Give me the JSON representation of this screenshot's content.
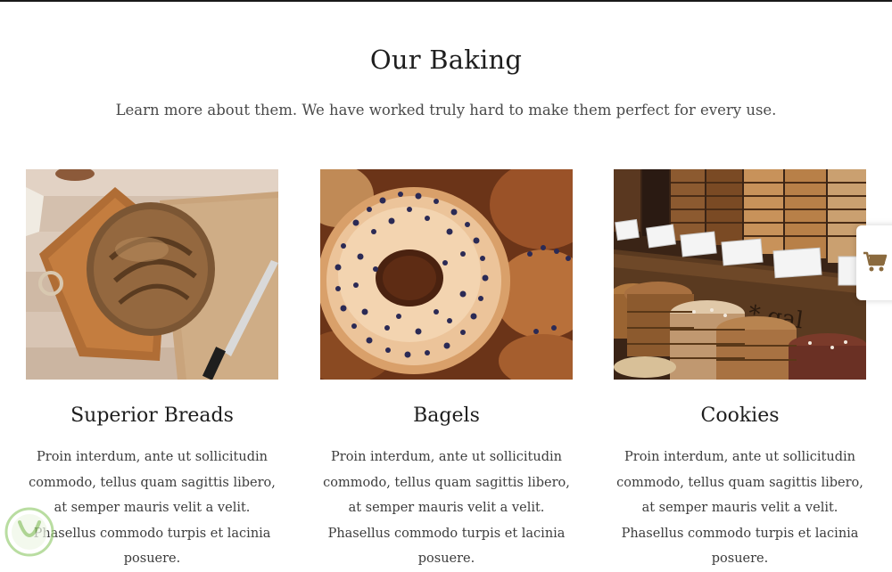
{
  "section": {
    "title": "Our Baking",
    "subtitle": "Learn more about them. We have worked truly hard to make them perfect for every use."
  },
  "cards": [
    {
      "title": "Superior Breads",
      "text": "Proin interdum, ante ut sollicitudin commodo, tellus quam sagittis libero, at semper mauris velit a velit. Phasellus commodo turpis et lacinia posuere.",
      "image": "bread-on-cutting-board-image"
    },
    {
      "title": "Bagels",
      "text": "Proin interdum, ante ut sollicitudin commodo, tellus quam sagittis libero, at semper mauris velit a velit. Phasellus commodo turpis et lacinia posuere.",
      "image": "poppy-seed-bagel-image"
    },
    {
      "title": "Cookies",
      "text": "Proin interdum, ante ut sollicitudin commodo, tellus quam sagittis libero, at semper mauris velit a velit. Phasellus commodo turpis et lacinia posuere.",
      "image": "cookie-display-image"
    }
  ],
  "cart": {
    "icon": "cart-icon",
    "color": "#8a6a3e"
  },
  "watermark": {
    "icon": "watermark-logo-icon",
    "color": "#9ccf7a"
  }
}
